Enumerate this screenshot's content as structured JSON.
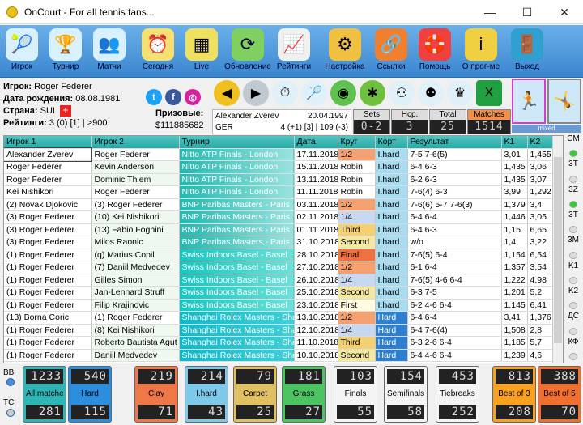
{
  "window": {
    "title": "OnCourt - For all tennis fans...",
    "min": "—",
    "max": "☐",
    "close": "✕"
  },
  "toolbar": [
    {
      "label": "Игрок",
      "icon": "player-icon",
      "glyph": "🎾",
      "color": "#d8f0ff"
    },
    {
      "label": "Турнир",
      "icon": "tournament-icon",
      "glyph": "🏆",
      "color": "#d8f0ff"
    },
    {
      "label": "Матчи",
      "icon": "matches-icon",
      "glyph": "👥",
      "color": "#d8f0ff"
    },
    {
      "label": "Сегодня",
      "icon": "today-icon",
      "glyph": "⏰",
      "color": "#f8e070"
    },
    {
      "label": "Live",
      "icon": "live-icon",
      "glyph": "▦",
      "color": "#f0e060"
    },
    {
      "label": "Обновление",
      "icon": "update-icon",
      "glyph": "⟳",
      "color": "#80d060"
    },
    {
      "label": "Рейтинги",
      "icon": "ratings-icon",
      "glyph": "📈",
      "color": "#f0f0f0"
    },
    {
      "label": "Настройка",
      "icon": "settings-icon",
      "glyph": "⚙",
      "color": "#f0c040"
    },
    {
      "label": "Ссылки",
      "icon": "links-icon",
      "glyph": "🔗",
      "color": "#f08030"
    },
    {
      "label": "Помощь",
      "icon": "help-icon",
      "glyph": "🛟",
      "color": "#f04040"
    },
    {
      "label": "О прог-ме",
      "icon": "about-icon",
      "glyph": "i",
      "color": "#f0d040"
    },
    {
      "label": "Выход",
      "icon": "exit-icon",
      "glyph": "🚪",
      "color": "#30a0d0"
    }
  ],
  "player": {
    "name_label": "Игрок:",
    "name": "Roger Federer",
    "dob_label": "Дата рождения:",
    "dob": "08.08.1981",
    "country_label": "Страна:",
    "country": "SUI",
    "ratings_label": "Рейтинги:",
    "ratings": "3 (0) [1] | >900",
    "prize_label": "Призовые:",
    "prize": "$111885682"
  },
  "h2h": {
    "opponent": "Alexander Zverev",
    "opp_dob": "20.04.1997",
    "opp_country": "GER",
    "opp_ratings": "4 (+1) [3] | 109 (-3)",
    "sets_label": "Sets",
    "sets": "0-2",
    "hcp_label": "Hcp.",
    "hcp": "3",
    "total_label": "Total",
    "total": "25",
    "matches_label": "Matches",
    "matches": "1514",
    "mixed": "mixed"
  },
  "table": {
    "headers": [
      "Игрок 1",
      "Игрок 2",
      "Турнир",
      "Дата",
      "Круг",
      "Корт",
      "Результат",
      "K1",
      "K2"
    ],
    "rows": [
      [
        "Alexander Zverev",
        "Roger Federer",
        "Nitto ATP Finals - London",
        "17.11.2018",
        "1/2",
        "I.hard",
        "7-5 7-6(5)",
        "3,01",
        "1,455"
      ],
      [
        "Roger Federer",
        "Kevin Anderson",
        "Nitto ATP Finals - London",
        "15.11.2018",
        "Robin",
        "I.hard",
        "6-4 6-3",
        "1,435",
        "3,06"
      ],
      [
        "Roger Federer",
        "Dominic Thiem",
        "Nitto ATP Finals - London",
        "13.11.2018",
        "Robin",
        "I.hard",
        "6-2 6-3",
        "1,435",
        "3,07"
      ],
      [
        "Kei Nishikori",
        "Roger Federer",
        "Nitto ATP Finals - London",
        "11.11.2018",
        "Robin",
        "I.hard",
        "7-6(4) 6-3",
        "3,99",
        "1,292"
      ],
      [
        "(2) Novak Djokovic",
        "(3) Roger Federer",
        "BNP Paribas Masters - Paris",
        "03.11.2018",
        "1/2",
        "I.hard",
        "7-6(6) 5-7 7-6(3)",
        "1,379",
        "3,4"
      ],
      [
        "(3) Roger Federer",
        "(10) Kei Nishikori",
        "BNP Paribas Masters - Paris",
        "02.11.2018",
        "1/4",
        "I.hard",
        "6-4 6-4",
        "1,446",
        "3,05"
      ],
      [
        "(3) Roger Federer",
        "(13) Fabio Fognini",
        "BNP Paribas Masters - Paris",
        "01.11.2018",
        "Third",
        "I.hard",
        "6-4 6-3",
        "1,15",
        "6,65"
      ],
      [
        "(3) Roger Federer",
        "Milos Raonic",
        "BNP Paribas Masters - Paris",
        "31.10.2018",
        "Second",
        "I.hard",
        "w/o",
        "1,4",
        "3,22"
      ],
      [
        "(1) Roger Federer",
        "(q) Marius Copil",
        "Swiss Indoors Basel - Basel",
        "28.10.2018",
        "Final",
        "I.hard",
        "7-6(5) 6-4",
        "1,154",
        "6,54"
      ],
      [
        "(1) Roger Federer",
        "(7) Daniil Medvedev",
        "Swiss Indoors Basel - Basel",
        "27.10.2018",
        "1/2",
        "I.hard",
        "6-1 6-4",
        "1,357",
        "3,54"
      ],
      [
        "(1) Roger Federer",
        "Gilles Simon",
        "Swiss Indoors Basel - Basel",
        "26.10.2018",
        "1/4",
        "I.hard",
        "7-6(5) 4-6 6-4",
        "1,222",
        "4,98"
      ],
      [
        "(1) Roger Federer",
        "Jan-Lennard Struff",
        "Swiss Indoors Basel - Basel",
        "25.10.2018",
        "Second",
        "I.hard",
        "6-3 7-5",
        "1,201",
        "5,2"
      ],
      [
        "(1) Roger Federer",
        "Filip Krajinovic",
        "Swiss Indoors Basel - Basel",
        "23.10.2018",
        "First",
        "I.hard",
        "6-2 4-6 6-4",
        "1,145",
        "6,41"
      ],
      [
        "(13) Borna Coric",
        "(1) Roger Federer",
        "Shanghai Rolex Masters - Shanghai",
        "13.10.2018",
        "1/2",
        "Hard",
        "6-4 6-4",
        "3,41",
        "1,376"
      ],
      [
        "(1) Roger Federer",
        "(8) Kei Nishikori",
        "Shanghai Rolex Masters - Shanghai",
        "12.10.2018",
        "1/4",
        "Hard",
        "6-4 7-6(4)",
        "1,508",
        "2,8"
      ],
      [
        "(1) Roger Federer",
        "Roberto Bautista Agut",
        "Shanghai Rolex Masters - Shanghai",
        "11.10.2018",
        "Third",
        "Hard",
        "6-3 2-6 6-4",
        "1,185",
        "5,7"
      ],
      [
        "(1) Roger Federer",
        "Daniil Medvedev",
        "Shanghai Rolex Masters - Shanghai",
        "10.10.2018",
        "Second",
        "Hard",
        "6-4 4-6 6-4",
        "1,239",
        "4,6"
      ]
    ]
  },
  "side": [
    "CM",
    "3Т",
    "3Z",
    "3T",
    "3M",
    "K1",
    "K2",
    "ДС",
    "КФ"
  ],
  "bottom_labels": {
    "bb": "BB",
    "tc": "TC"
  },
  "stats": [
    {
      "label": "All matches",
      "top": "1233",
      "bot": "281",
      "color": "#2fb5b5"
    },
    {
      "label": "Hard",
      "top": "540",
      "bot": "115",
      "color": "#2e8ede"
    },
    {
      "label": "Clay",
      "top": "219",
      "bot": "71",
      "color": "#f07848"
    },
    {
      "label": "I.hard",
      "top": "214",
      "bot": "43",
      "color": "#7ec8ea"
    },
    {
      "label": "Carpet",
      "top": "79",
      "bot": "25",
      "color": "#e0c060"
    },
    {
      "label": "Grass",
      "top": "181",
      "bot": "27",
      "color": "#4cc464"
    },
    {
      "label": "Finals",
      "top": "103",
      "bot": "55",
      "color": "#f4f4f4"
    },
    {
      "label": "Semifinals",
      "top": "154",
      "bot": "58",
      "color": "#f4f4f4"
    },
    {
      "label": "Tiebreaks",
      "top": "453",
      "bot": "252",
      "color": "#f4f4f4"
    },
    {
      "label": "Best of 3",
      "top": "813",
      "bot": "208",
      "color": "#f8a020"
    },
    {
      "label": "Best of 5",
      "top": "388",
      "bot": "70",
      "color": "#f07030"
    }
  ]
}
